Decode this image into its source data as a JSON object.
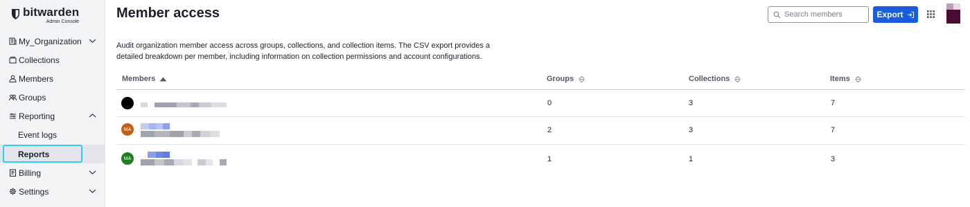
{
  "brand": {
    "name": "bitwarden",
    "subtitle": "Admin Console"
  },
  "sidebar": {
    "items": [
      {
        "label": "My_Organization",
        "icon": "organization-icon",
        "expand": "chevron-down-icon"
      },
      {
        "label": "Collections",
        "icon": "collection-icon"
      },
      {
        "label": "Members",
        "icon": "user-icon"
      },
      {
        "label": "Groups",
        "icon": "users-icon"
      },
      {
        "label": "Reporting",
        "icon": "sliders-icon",
        "expand": "chevron-up-icon"
      },
      {
        "label": "Event logs"
      },
      {
        "label": "Reports"
      },
      {
        "label": "Billing",
        "icon": "billing-icon",
        "expand": "chevron-down-icon"
      },
      {
        "label": "Settings",
        "icon": "gear-icon",
        "expand": "chevron-down-icon"
      }
    ]
  },
  "header": {
    "title": "Member access",
    "search_placeholder": "Search members",
    "export_label": "Export"
  },
  "description": "Audit organization member access across groups, collections, and collection items. The CSV export provides a detailed breakdown per member, including information on collection permissions and account configurations.",
  "table": {
    "columns": [
      "Members",
      "Groups",
      "Collections",
      "Items"
    ],
    "rows": [
      {
        "avatar": "",
        "avatar_color": "#000000",
        "groups": "0",
        "collections": "3",
        "items": "7"
      },
      {
        "avatar": "MA",
        "avatar_color": "#c0601b",
        "groups": "2",
        "collections": "3",
        "items": "7"
      },
      {
        "avatar": "MA",
        "avatar_color": "#1e7d1e",
        "groups": "1",
        "collections": "1",
        "items": "3"
      }
    ]
  },
  "colors": {
    "accent": "#175ddc",
    "focus_ring": "#2bd0ea"
  }
}
